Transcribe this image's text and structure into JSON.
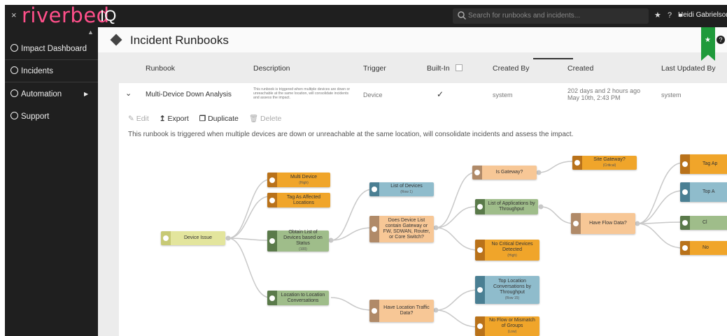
{
  "topbar": {
    "close": "×",
    "logo": "riverbed",
    "logo_suffix": "IQ",
    "search_placeholder": "Search for runbooks and incidents...",
    "user": "Heidi Gabrielson"
  },
  "sidebar": {
    "items": [
      {
        "label": "Impact Dashboard",
        "icon": "globe-icon"
      },
      {
        "label": "Incidents",
        "icon": "alert-circle-icon"
      },
      {
        "label": "Automation",
        "icon": "gear-icon"
      },
      {
        "label": "Support",
        "icon": "globe-icon"
      }
    ]
  },
  "page": {
    "title": "Incident Runbooks"
  },
  "table": {
    "headers": [
      "Runbook",
      "Description",
      "Trigger",
      "Built-In",
      "Created By",
      "Created",
      "Last Updated By"
    ],
    "row": {
      "runbook": "Multi-Device Down Analysis",
      "description": "This runbook is triggered when multiple devices are down or unreachable at the same location, will consolidate incidents and assess the impact.",
      "trigger": "Device",
      "built_in": "✓",
      "created_by": "system",
      "created_rel": "202 days and 2 hours ago",
      "created_date": "May 10th, 2:43 PM",
      "updated_by": "system"
    }
  },
  "actions": {
    "edit": "Edit",
    "export": "Export",
    "duplicate": "Duplicate",
    "delete": "Delete"
  },
  "description": "This runbook is triggered when multiple devices are down or unreachable at the same location, will consolidate incidents and assess the impact.",
  "flow": {
    "nodes": {
      "device_issue": "Device Issue",
      "multi_device": "Multi Device",
      "multi_device_sub": "(High)",
      "tag_affected": "Tag As Affected Locations",
      "obtain_list": "Obtain List of Devices based on Status",
      "obtain_list_sub": "(100)",
      "location_conv": "Location to Location Conversations",
      "list_devices": "List of Devices",
      "list_devices_sub": "(Row 1)",
      "does_list": "Does Device List contain Gateway or FW, SDWAN, Router, or Core Switch?",
      "have_location": "Have Location Traffic Data?",
      "is_gateway": "Is Gateway?",
      "list_apps": "List of Applications by Throughput",
      "no_critical": "No Critical Devices Detected",
      "no_critical_sub": "(High)",
      "top_location": "Top Location Conversations by Throughput",
      "top_location_sub": "(Row 15)",
      "no_flow": "No Flow or Mismatch of Groups",
      "no_flow_sub": "(Low)",
      "site_gateway": "Site Gateway?",
      "site_gateway_sub": "(Critical)",
      "have_flow": "Have Flow Data?",
      "tag_ap": "Tag Ap",
      "top_a": "Top A",
      "cl": "Cl",
      "no": "No"
    }
  }
}
